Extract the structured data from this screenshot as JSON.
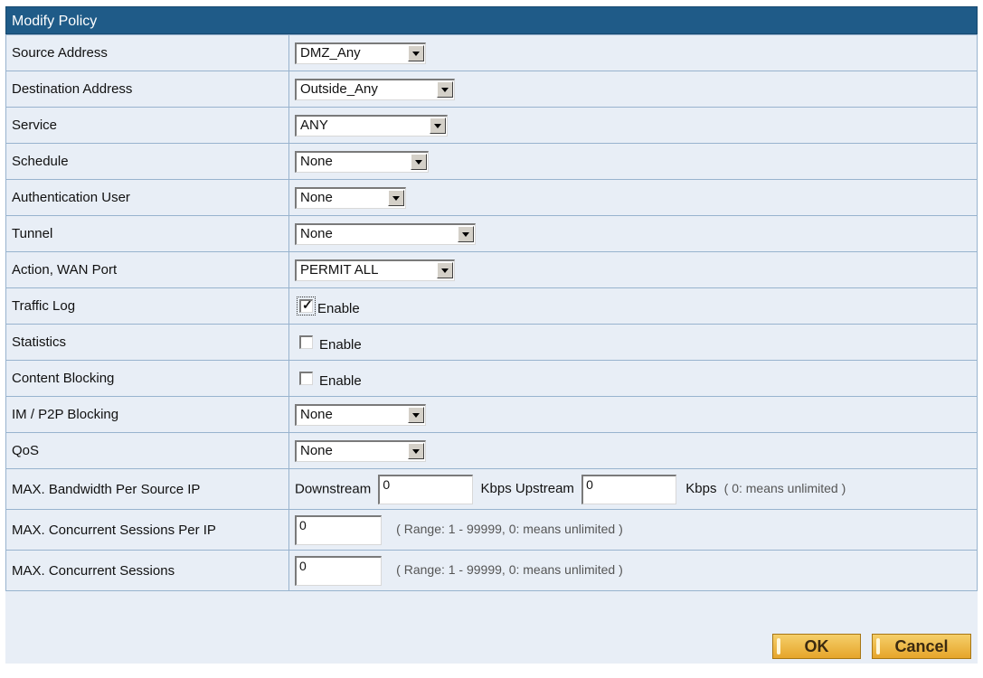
{
  "title": "Modify Policy",
  "rows": {
    "source_address": {
      "label": "Source Address",
      "value": "DMZ_Any"
    },
    "destination_address": {
      "label": "Destination Address",
      "value": "Outside_Any"
    },
    "service": {
      "label": "Service",
      "value": "ANY"
    },
    "schedule": {
      "label": "Schedule",
      "value": "None"
    },
    "auth_user": {
      "label": "Authentication User",
      "value": "None"
    },
    "tunnel": {
      "label": "Tunnel",
      "value": "None"
    },
    "action": {
      "label": "Action, WAN Port",
      "value": "PERMIT ALL"
    },
    "traffic_log": {
      "label": "Traffic Log",
      "checked": true,
      "text": "Enable"
    },
    "statistics": {
      "label": "Statistics",
      "checked": false,
      "text": "Enable"
    },
    "content_blocking": {
      "label": "Content Blocking",
      "checked": false,
      "text": "Enable"
    },
    "im_p2p": {
      "label": "IM / P2P Blocking",
      "value": "None"
    },
    "qos": {
      "label": "QoS",
      "value": "None"
    },
    "max_bandwidth": {
      "label": "MAX. Bandwidth Per Source IP",
      "downstream_label": "Downstream",
      "downstream_value": "0",
      "upstream_label": "Kbps Upstream",
      "upstream_value": "0",
      "unit_hint": "Kbps",
      "hint": "( 0: means unlimited )"
    },
    "max_sessions_per_ip": {
      "label": "MAX. Concurrent Sessions Per IP",
      "value": "0",
      "hint": "( Range: 1 - 99999, 0: means unlimited )"
    },
    "max_sessions": {
      "label": "MAX. Concurrent Sessions",
      "value": "0",
      "hint": "( Range: 1 - 99999, 0: means unlimited )"
    }
  },
  "buttons": {
    "ok": "OK",
    "cancel": "Cancel"
  },
  "colors": {
    "title_bg": "#1f5b88",
    "panel_bg": "#e8eef6",
    "button": "#e6a52a"
  }
}
